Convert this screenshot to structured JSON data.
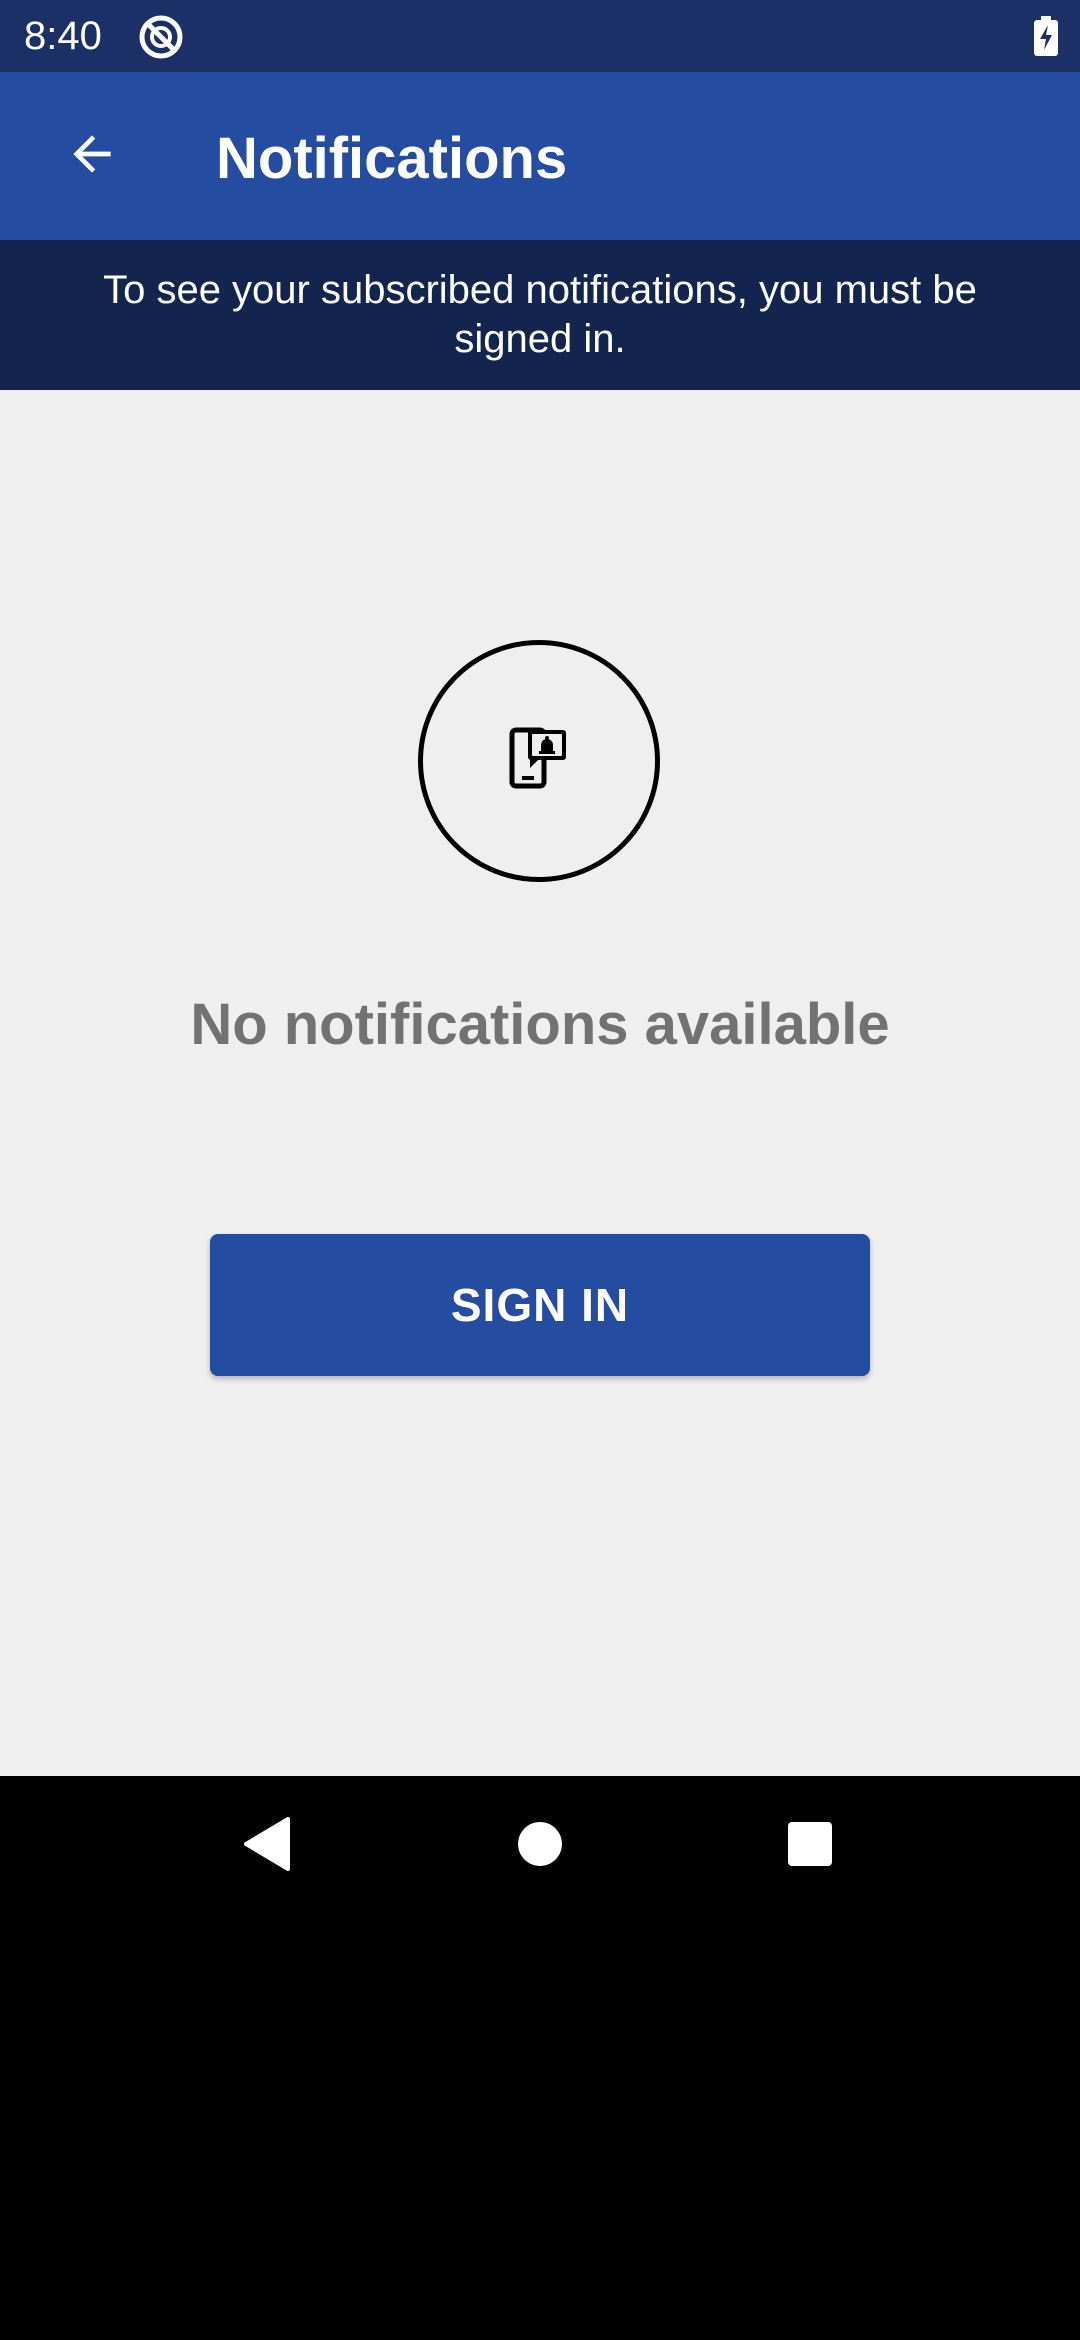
{
  "status_bar": {
    "time": "8:40",
    "app_icon": "sync-status-icon",
    "battery_icon": "battery-charging-icon"
  },
  "app_bar": {
    "back_icon": "arrow-back-icon",
    "title": "Notifications"
  },
  "banner": {
    "text": "To see your subscribed notifications, you must be signed in."
  },
  "empty_state": {
    "icon": "phone-notification-bell-icon",
    "title": "No notifications available",
    "button_label": "SIGN IN"
  },
  "nav_bar": {
    "back": "nav-back-icon",
    "home": "nav-home-icon",
    "recents": "nav-recents-icon"
  },
  "colors": {
    "status_bar": "#1b3066",
    "app_bar": "#244ca1",
    "banner": "#13254f",
    "content_bg": "#efefef",
    "empty_text": "#727272",
    "button": "#244ca1"
  }
}
